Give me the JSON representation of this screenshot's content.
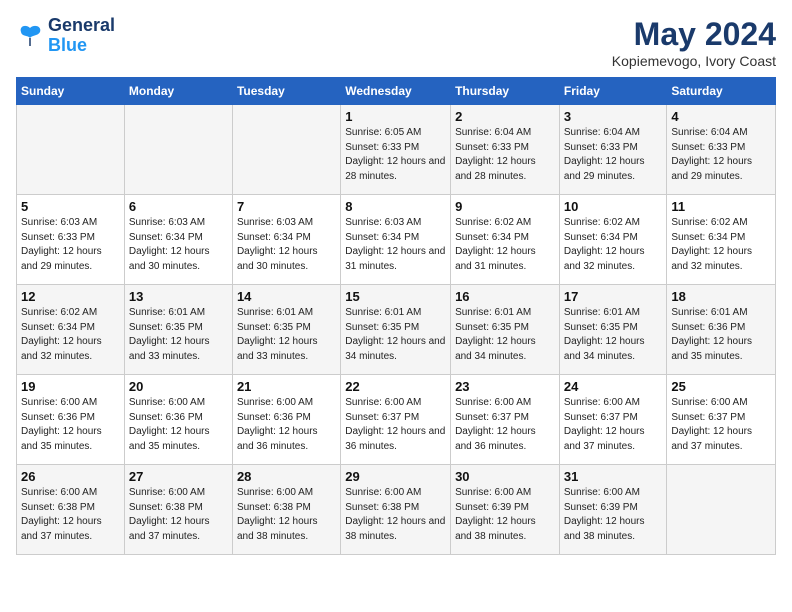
{
  "header": {
    "logo_line1": "General",
    "logo_line2": "Blue",
    "month": "May 2024",
    "location": "Kopiemevogo, Ivory Coast"
  },
  "days_of_week": [
    "Sunday",
    "Monday",
    "Tuesday",
    "Wednesday",
    "Thursday",
    "Friday",
    "Saturday"
  ],
  "weeks": [
    [
      {
        "day": "",
        "info": ""
      },
      {
        "day": "",
        "info": ""
      },
      {
        "day": "",
        "info": ""
      },
      {
        "day": "1",
        "info": "Sunrise: 6:05 AM\nSunset: 6:33 PM\nDaylight: 12 hours and 28 minutes."
      },
      {
        "day": "2",
        "info": "Sunrise: 6:04 AM\nSunset: 6:33 PM\nDaylight: 12 hours and 28 minutes."
      },
      {
        "day": "3",
        "info": "Sunrise: 6:04 AM\nSunset: 6:33 PM\nDaylight: 12 hours and 29 minutes."
      },
      {
        "day": "4",
        "info": "Sunrise: 6:04 AM\nSunset: 6:33 PM\nDaylight: 12 hours and 29 minutes."
      }
    ],
    [
      {
        "day": "5",
        "info": "Sunrise: 6:03 AM\nSunset: 6:33 PM\nDaylight: 12 hours and 29 minutes."
      },
      {
        "day": "6",
        "info": "Sunrise: 6:03 AM\nSunset: 6:34 PM\nDaylight: 12 hours and 30 minutes."
      },
      {
        "day": "7",
        "info": "Sunrise: 6:03 AM\nSunset: 6:34 PM\nDaylight: 12 hours and 30 minutes."
      },
      {
        "day": "8",
        "info": "Sunrise: 6:03 AM\nSunset: 6:34 PM\nDaylight: 12 hours and 31 minutes."
      },
      {
        "day": "9",
        "info": "Sunrise: 6:02 AM\nSunset: 6:34 PM\nDaylight: 12 hours and 31 minutes."
      },
      {
        "day": "10",
        "info": "Sunrise: 6:02 AM\nSunset: 6:34 PM\nDaylight: 12 hours and 32 minutes."
      },
      {
        "day": "11",
        "info": "Sunrise: 6:02 AM\nSunset: 6:34 PM\nDaylight: 12 hours and 32 minutes."
      }
    ],
    [
      {
        "day": "12",
        "info": "Sunrise: 6:02 AM\nSunset: 6:34 PM\nDaylight: 12 hours and 32 minutes."
      },
      {
        "day": "13",
        "info": "Sunrise: 6:01 AM\nSunset: 6:35 PM\nDaylight: 12 hours and 33 minutes."
      },
      {
        "day": "14",
        "info": "Sunrise: 6:01 AM\nSunset: 6:35 PM\nDaylight: 12 hours and 33 minutes."
      },
      {
        "day": "15",
        "info": "Sunrise: 6:01 AM\nSunset: 6:35 PM\nDaylight: 12 hours and 34 minutes."
      },
      {
        "day": "16",
        "info": "Sunrise: 6:01 AM\nSunset: 6:35 PM\nDaylight: 12 hours and 34 minutes."
      },
      {
        "day": "17",
        "info": "Sunrise: 6:01 AM\nSunset: 6:35 PM\nDaylight: 12 hours and 34 minutes."
      },
      {
        "day": "18",
        "info": "Sunrise: 6:01 AM\nSunset: 6:36 PM\nDaylight: 12 hours and 35 minutes."
      }
    ],
    [
      {
        "day": "19",
        "info": "Sunrise: 6:00 AM\nSunset: 6:36 PM\nDaylight: 12 hours and 35 minutes."
      },
      {
        "day": "20",
        "info": "Sunrise: 6:00 AM\nSunset: 6:36 PM\nDaylight: 12 hours and 35 minutes."
      },
      {
        "day": "21",
        "info": "Sunrise: 6:00 AM\nSunset: 6:36 PM\nDaylight: 12 hours and 36 minutes."
      },
      {
        "day": "22",
        "info": "Sunrise: 6:00 AM\nSunset: 6:37 PM\nDaylight: 12 hours and 36 minutes."
      },
      {
        "day": "23",
        "info": "Sunrise: 6:00 AM\nSunset: 6:37 PM\nDaylight: 12 hours and 36 minutes."
      },
      {
        "day": "24",
        "info": "Sunrise: 6:00 AM\nSunset: 6:37 PM\nDaylight: 12 hours and 37 minutes."
      },
      {
        "day": "25",
        "info": "Sunrise: 6:00 AM\nSunset: 6:37 PM\nDaylight: 12 hours and 37 minutes."
      }
    ],
    [
      {
        "day": "26",
        "info": "Sunrise: 6:00 AM\nSunset: 6:38 PM\nDaylight: 12 hours and 37 minutes."
      },
      {
        "day": "27",
        "info": "Sunrise: 6:00 AM\nSunset: 6:38 PM\nDaylight: 12 hours and 37 minutes."
      },
      {
        "day": "28",
        "info": "Sunrise: 6:00 AM\nSunset: 6:38 PM\nDaylight: 12 hours and 38 minutes."
      },
      {
        "day": "29",
        "info": "Sunrise: 6:00 AM\nSunset: 6:38 PM\nDaylight: 12 hours and 38 minutes."
      },
      {
        "day": "30",
        "info": "Sunrise: 6:00 AM\nSunset: 6:39 PM\nDaylight: 12 hours and 38 minutes."
      },
      {
        "day": "31",
        "info": "Sunrise: 6:00 AM\nSunset: 6:39 PM\nDaylight: 12 hours and 38 minutes."
      },
      {
        "day": "",
        "info": ""
      }
    ]
  ]
}
